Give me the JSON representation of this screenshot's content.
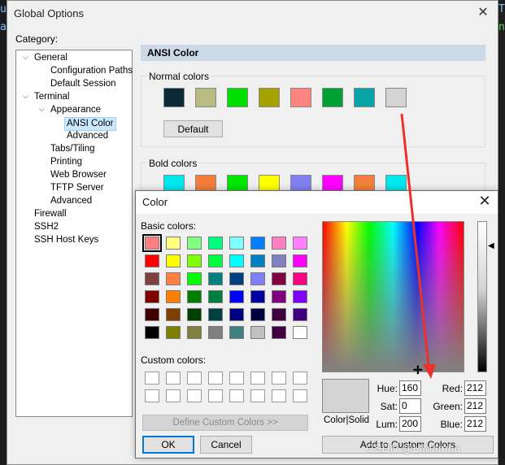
{
  "terminal": {
    "glyph_left_top": "u",
    "glyph_left_mid": "a",
    "glyph_right_top": "T",
    "glyph_right_mid": "n"
  },
  "global_options": {
    "title": "Global Options",
    "category_label": "Category:",
    "tree": [
      {
        "label": "General",
        "level": 0,
        "toggle": "⌄"
      },
      {
        "label": "Configuration Paths",
        "level": 1
      },
      {
        "label": "Default Session",
        "level": 1
      },
      {
        "label": "Terminal",
        "level": 0,
        "toggle": "⌄"
      },
      {
        "label": "Appearance",
        "level": 1,
        "toggle": "⌄"
      },
      {
        "label": "ANSI Color",
        "level": 2,
        "selected": true
      },
      {
        "label": "Advanced",
        "level": 2
      },
      {
        "label": "Tabs/Tiling",
        "level": 1
      },
      {
        "label": "Printing",
        "level": 1
      },
      {
        "label": "Web Browser",
        "level": 1
      },
      {
        "label": "TFTP Server",
        "level": 1
      },
      {
        "label": "Advanced",
        "level": 1
      },
      {
        "label": "Firewall",
        "level": 0
      },
      {
        "label": "SSH2",
        "level": 0
      },
      {
        "label": "SSH Host Keys",
        "level": 0
      }
    ],
    "section_title": "ANSI Color",
    "normal_colors_label": "Normal colors",
    "normal_colors": [
      "#0c2a36",
      "#b8bc7e",
      "#00e000",
      "#a6a200",
      "#ff8480",
      "#00a033",
      "#0aa3a8",
      "#d4d4d4"
    ],
    "default_button": "Default",
    "bold_colors_label": "Bold colors",
    "bold_colors": [
      "#00e8ee",
      "#f47c3a",
      "#00e600",
      "#ffff00",
      "#8080f0",
      "#ff00ff",
      "#f2803a",
      "#00e8ee"
    ]
  },
  "color_dialog": {
    "title": "Color",
    "basic_colors_label": "Basic colors:",
    "basic_colors": [
      [
        "#ff8080",
        "#ffff80",
        "#80ff80",
        "#00ff80",
        "#80ffff",
        "#0080ff",
        "#ff80c0",
        "#ff80ff"
      ],
      [
        "#ff0000",
        "#ffff00",
        "#80ff00",
        "#00ff40",
        "#00ffff",
        "#0080c0",
        "#8080c0",
        "#ff00ff"
      ],
      [
        "#804040",
        "#ff8040",
        "#00ff00",
        "#008080",
        "#004080",
        "#8080ff",
        "#800040",
        "#ff0080"
      ],
      [
        "#800000",
        "#ff8000",
        "#008000",
        "#008040",
        "#0000ff",
        "#0000a0",
        "#800080",
        "#8000ff"
      ],
      [
        "#400000",
        "#804000",
        "#004000",
        "#004040",
        "#000080",
        "#000040",
        "#400040",
        "#400080"
      ],
      [
        "#000000",
        "#808000",
        "#808040",
        "#808080",
        "#408080",
        "#c0c0c0",
        "#400040",
        "#ffffff"
      ]
    ],
    "custom_colors_label": "Custom colors:",
    "define_button": "Define Custom Colors >>",
    "ok_button": "OK",
    "cancel_button": "Cancel",
    "preview_color": "#d4d4d4",
    "preview_label": "Color|Solid",
    "hue_label": "Hue:",
    "hue": "160",
    "sat_label": "Sat:",
    "sat": "0",
    "lum_label": "Lum:",
    "lum": "200",
    "red_label": "Red:",
    "red": "212",
    "green_label": "Green:",
    "green": "212",
    "blue_label": "Blue:",
    "blue": "212",
    "add_button": "Add to Custom Colors"
  },
  "watermark": "CSDN @LtMamba",
  "accent_colors": {
    "selection": "#cce8ff",
    "section_header": "#ccd9e6",
    "annotation_arrow": "#e8322b"
  }
}
